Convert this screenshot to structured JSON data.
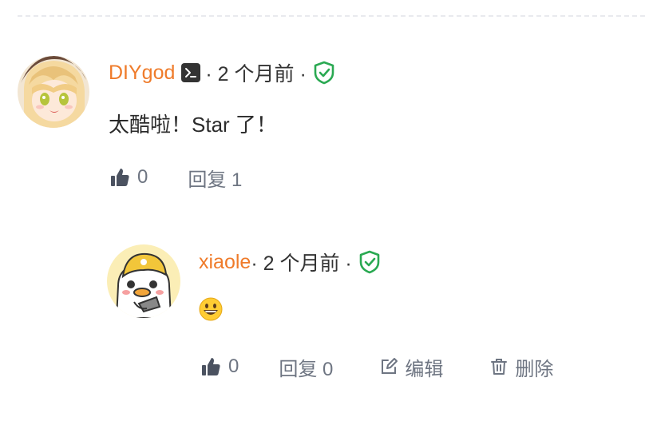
{
  "comment": {
    "author": "DIYgod",
    "meta_before": " · 2 个月前 · ",
    "text": "太酷啦！Star 了！",
    "likes": "0",
    "reply_label": "回复 1"
  },
  "reply": {
    "author": "xiaole",
    "meta": " · 2 个月前 · ",
    "likes": "0",
    "reply_label": "回复 0",
    "edit_label": "编辑",
    "delete_label": "删除"
  },
  "colors": {
    "username": "#ef7b2a",
    "verified": "#2aa952",
    "action_text": "#6e7582"
  },
  "icons": [
    "terminal-icon",
    "verified-shield-icon",
    "thumbs-up-icon",
    "edit-icon",
    "trash-icon",
    "grinning-emoji-icon"
  ]
}
